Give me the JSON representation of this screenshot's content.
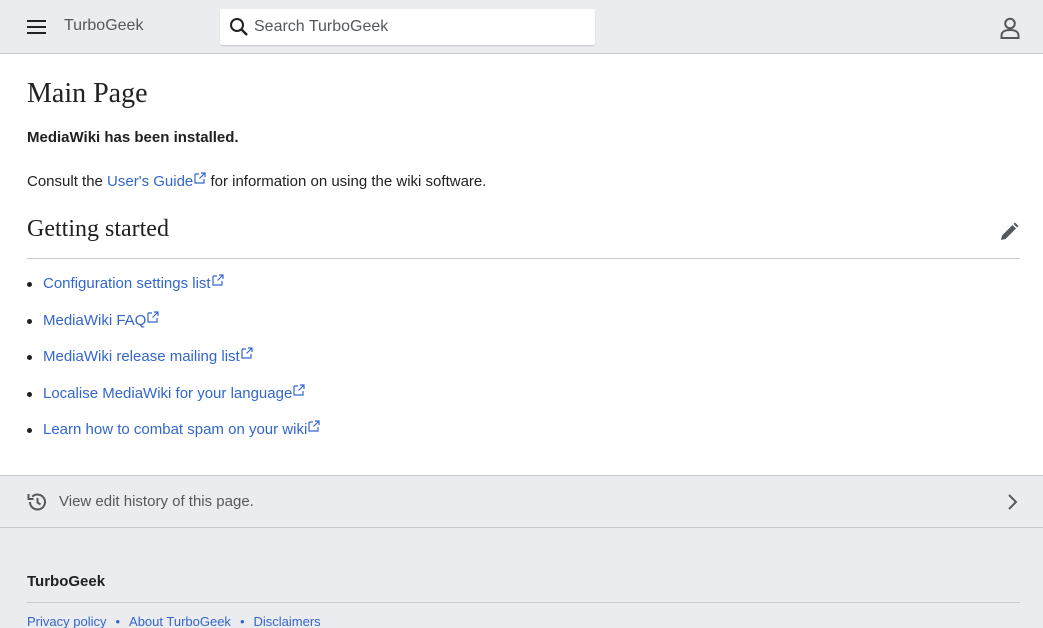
{
  "header": {
    "site_name": "TurboGeek",
    "search_placeholder": "Search TurboGeek"
  },
  "main": {
    "title": "Main Page",
    "installed_text": "MediaWiki has been installed.",
    "consult_prefix": "Consult the ",
    "consult_link": "User's Guide",
    "consult_suffix": " for information on using the wiki software.",
    "section_title": "Getting started",
    "links": [
      "Configuration settings list",
      "MediaWiki FAQ",
      "MediaWiki release mailing list",
      "Localise MediaWiki for your language",
      "Learn how to combat spam on your wiki"
    ]
  },
  "history": {
    "label": "View edit history of this page."
  },
  "footer": {
    "title": "TurboGeek",
    "links": [
      "Privacy policy",
      "About TurboGeek",
      "Disclaimers"
    ],
    "separator": "•"
  },
  "colors": {
    "link": "#3366cc",
    "header_bg": "#eaecf0",
    "text": "#202122"
  },
  "icons": [
    "menu-icon",
    "search-icon",
    "user-icon",
    "edit-pencil-icon",
    "external-link-icon",
    "history-icon",
    "chevron-right-icon"
  ]
}
